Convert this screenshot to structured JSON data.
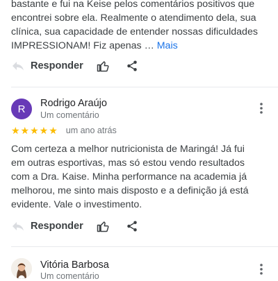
{
  "colors": {
    "link": "#1a73e8",
    "star": "#fbbc04",
    "avatar_r": "#673ab7",
    "text": "#3c4043",
    "meta": "#70757a"
  },
  "review1": {
    "text_lines": [
      "bastante e fui na Keise pelos comentários positivos que",
      "encontrei sobre ela. Realmente o atendimento dela, sua",
      "clínica, sua capacidade de entender nossas dificuldades",
      "IMPRESSIONAM! Fiz apenas …"
    ],
    "more_label": "Mais",
    "reply_label": "Responder",
    "icons": {
      "reply": "reply-icon",
      "like": "thumbs-up-icon",
      "share": "share-icon"
    }
  },
  "review2": {
    "avatar_letter": "R",
    "name": "Rodrigo Araújo",
    "meta": "Um comentário",
    "stars": "★★★★★",
    "rating": 5,
    "time": "um ano atrás",
    "text_lines": [
      "Com certeza a melhor nutricionista de Maringá! Já fui",
      "em outras esportivas, mas só estou vendo resultados",
      "com a Dra. Kaise. Minha performance na academia já",
      "melhorou, me sinto mais disposto e a definição já está",
      "evidente. Vale o investimento."
    ],
    "reply_label": "Responder",
    "icons": {
      "menu": "more-vert-icon",
      "reply": "reply-icon",
      "like": "thumbs-up-icon",
      "share": "share-icon"
    }
  },
  "review3": {
    "name": "Vitória Barbosa",
    "meta": "Um comentário",
    "icons": {
      "avatar": "profile-photo",
      "menu": "more-vert-icon"
    }
  }
}
